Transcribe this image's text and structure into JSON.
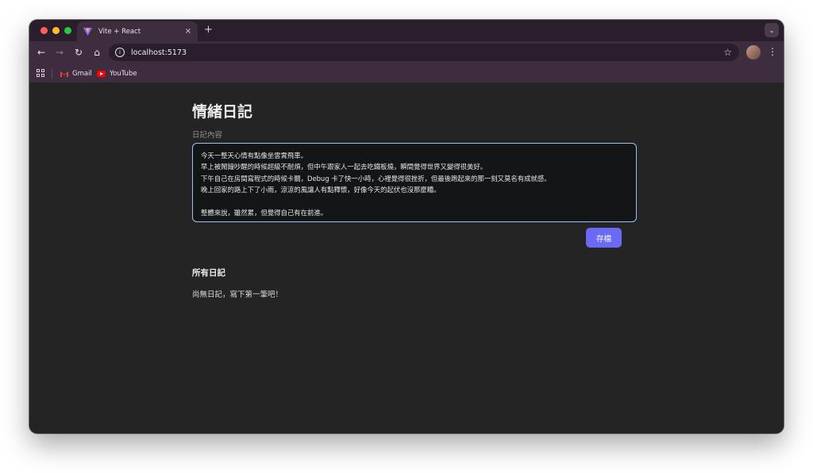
{
  "browser": {
    "tab": {
      "title": "Vite + React",
      "close": "×",
      "favicon": "vite-logo-icon"
    },
    "new_tab": "+",
    "tab_search": "⌄",
    "nav": {
      "back": "←",
      "forward": "→",
      "reload": "↻",
      "home": "⌂"
    },
    "address": {
      "url": "localhost:5173",
      "site_info": "i",
      "bookmark_star": "☆"
    },
    "menu": "⋮",
    "bookmarks": [
      {
        "label": "Gmail",
        "icon": "gmail-icon"
      },
      {
        "label": "YouTube",
        "icon": "youtube-icon"
      }
    ]
  },
  "page": {
    "title": "情緒日記",
    "field_label": "日記內容",
    "textarea_value": "今天一整天心情有點像坐雲霄飛車。\n早上被鬧鐘吵醒的時候超級不耐煩，但中午跟家人一起去吃鐵板燒，瞬間覺得世界又變得很美好。\n下午自己在房間寫程式的時候卡關，Debug 卡了快一小時，心裡覺得很挫折，但最後跑起來的那一刻又莫名有成就感。\n晚上回家的路上下了小雨，涼涼的風讓人有點釋懷，好像今天的起伏也沒那麼糟。\n\n整體來說，雖然累，但覺得自己有在前進。",
    "save_label": "存檔",
    "section_title": "所有日記",
    "empty_message": "尚無日記，寫下第一筆吧！"
  },
  "colors": {
    "accent": "#6a6af4",
    "page_bg": "#242424",
    "focus_border": "#9cc3f0",
    "browser_frame": "#3d2d3f"
  }
}
